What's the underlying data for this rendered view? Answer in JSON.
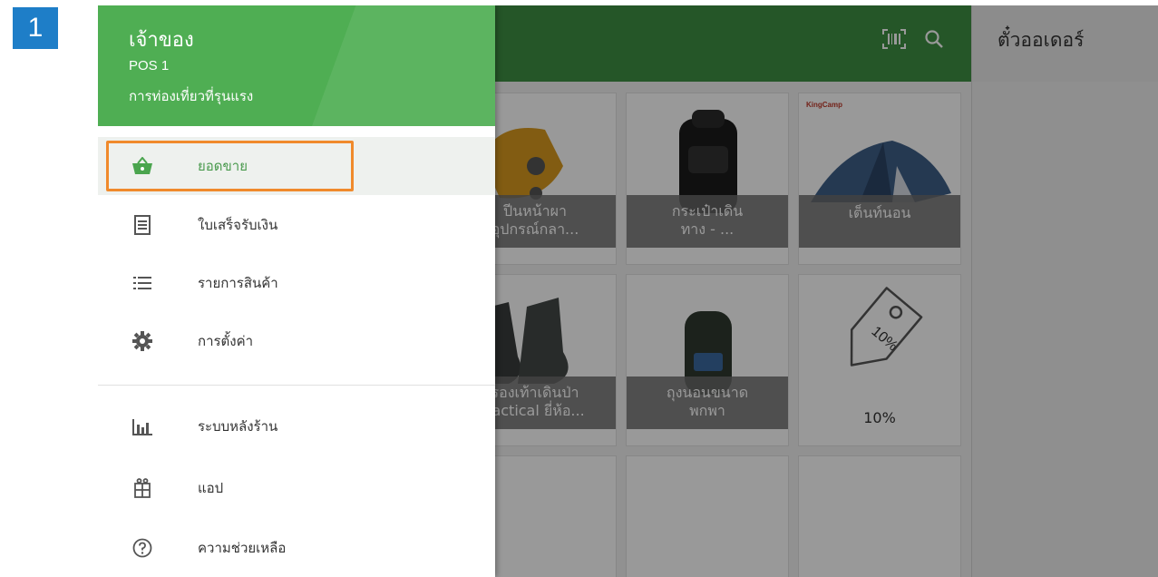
{
  "step": {
    "number": "1"
  },
  "drawer": {
    "owner": "เจ้าของ",
    "pos": "POS 1",
    "store": "การท่องเที่ยวที่รุนแรง",
    "items": [
      {
        "label": "ยอดขาย",
        "icon": "basket-icon",
        "active": true
      },
      {
        "label": "ใบเสร็จรับเงิน",
        "icon": "receipt-icon"
      },
      {
        "label": "รายการสินค้า",
        "icon": "list-icon"
      },
      {
        "label": "การตั้งค่า",
        "icon": "gear-icon"
      },
      {
        "label": "ระบบหลังร้าน",
        "icon": "bar-chart-icon"
      },
      {
        "label": "แอป",
        "icon": "apps-icon"
      },
      {
        "label": "ความช่วยเหลือ",
        "icon": "help-icon"
      }
    ]
  },
  "toolbar": {
    "barcode_icon": "barcode-icon",
    "search_icon": "search-icon"
  },
  "ticket": {
    "title": "ตั๋วออเดอร์"
  },
  "grid": {
    "tiles": [
      {
        "label": "ปีนหน้าผา\nอุปกรณ์กลา..."
      },
      {
        "label": "กระเป๋าเดิน\nทาง - ...",
        "image": "backpack"
      },
      {
        "label": "เต็นท์นอน",
        "image": "tent",
        "brand": "KingCamp"
      },
      {
        "label": "รองเท้าเดินป่า\nTactical ยี่ห้อ...",
        "image": "boots"
      },
      {
        "label": "ถุงนอนขนาด\nพกพา",
        "image": "sleeping-bag"
      },
      {
        "label": "10%",
        "image": "discount-tag",
        "tag_text": "10%"
      }
    ]
  },
  "colors": {
    "toolbar": "#3f8f43",
    "drawer_header": "#4fae53",
    "accent": "#4a9a4e",
    "highlight": "#f08a2c",
    "badge": "#1e7ec8"
  }
}
